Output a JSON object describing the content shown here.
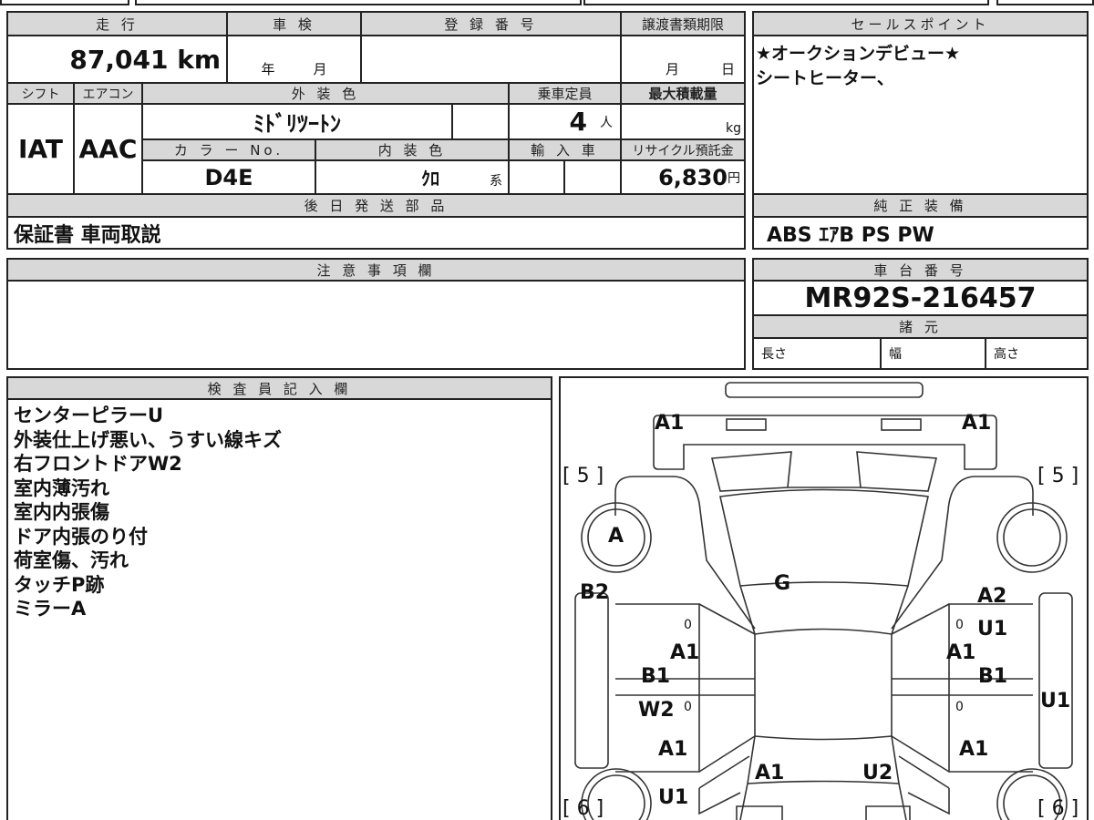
{
  "headers": {
    "mileage": "走 行",
    "inspection": "車 検",
    "registration": "登 録 番 号",
    "transfer_deadline": "譲渡書類期限",
    "shift": "シフト",
    "aircon": "エアコン",
    "exterior_color": "外 装 色",
    "capacity": "乗車定員",
    "max_load": "最大積載量",
    "color_no": "カ ラ ー No.",
    "interior_color": "内 装 色",
    "import": "輸 入 車",
    "recycle": "リサイクル預託金",
    "later_parts": "後 日 発 送 部 品",
    "sales_point": "セールスポイント",
    "standard_equipment": "純 正 装 備",
    "notes": "注 意 事 項 欄",
    "chassis_no": "車 台 番 号",
    "specs": "諸 元",
    "inspector": "検 査 員 記 入 欄"
  },
  "values": {
    "mileage": "87,041 km",
    "inspection_year": "年",
    "inspection_month": "月",
    "transfer_month": "月",
    "transfer_day": "日",
    "shift": "IAT",
    "aircon": "AAC",
    "exterior_color": "ﾐﾄﾞﾘﾂｰﾄﾝ",
    "capacity": "4",
    "capacity_unit": "人",
    "load_unit": "kg",
    "color_no": "D4E",
    "interior_color": "ｸﾛ",
    "interior_suffix": "系",
    "recycle": "6,830",
    "recycle_unit": "円",
    "later_parts": "保証書 車両取説",
    "standard_equipment": "ABS ｴｱB PS PW",
    "chassis_no": "MR92S-216457",
    "length": "長さ",
    "width": "幅",
    "height": "高さ"
  },
  "sales_points": [
    "★オークションデビュー★",
    "シートヒーター、"
  ],
  "inspector_notes": [
    "センターピラーU",
    "外装仕上げ悪い、うすい線キズ",
    "右フロントドアW2",
    "室内薄汚れ",
    "室内内張傷",
    "ドア内張のり付",
    "荷室傷、汚れ",
    "タッチP跡",
    "ミラーA"
  ],
  "diagram": {
    "rear_left": "A1",
    "rear_right": "A1",
    "tire_rl": "[ 5 ]",
    "tire_rr": "[ 5 ]",
    "wheel_rl": "A",
    "rear_quarter_left": "B2",
    "rear_glass": "G",
    "rear_door_right_1": "A2",
    "rear_door_right_2": "U1",
    "pillar_left": "A1",
    "pillar_right": "A1",
    "front_door_left_1": "B1",
    "front_door_right": "B1",
    "front_door_left_2": "W2",
    "quarter_right": "U1",
    "fender_left": "A1",
    "fender_right": "A1",
    "hood_left": "A1",
    "hood_right": "U2",
    "front_left": "U1",
    "tire_fl": "[ 6 ]",
    "tire_fr": "[ 6 ]",
    "mark": "0"
  }
}
